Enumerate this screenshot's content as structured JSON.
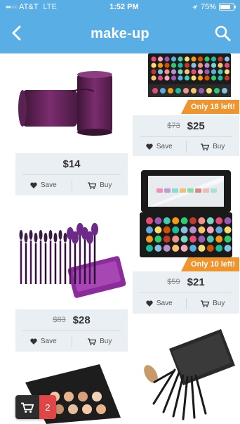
{
  "status_bar": {
    "carrier": "AT&T",
    "network": "LTE",
    "time": "1:52 PM",
    "battery": "75%",
    "battery_level": 0.75
  },
  "header": {
    "title": "make-up",
    "back_icon": "chevron-left-icon",
    "search_icon": "search-icon"
  },
  "actions": {
    "save_label": "Save",
    "buy_label": "Buy"
  },
  "products": [
    {
      "id": "brush-holder",
      "old_price": "",
      "price": "$14",
      "badge": ""
    },
    {
      "id": "palette-large",
      "old_price": "$73",
      "price": "$25",
      "badge": "Only 18 left!"
    },
    {
      "id": "brush-set-purple",
      "old_price": "$83",
      "price": "$28",
      "badge": ""
    },
    {
      "id": "palette-mirror",
      "old_price": "$59",
      "price": "$21",
      "badge": "Only 10 left!"
    }
  ],
  "cart": {
    "count": "2"
  },
  "colors": {
    "header_bg": "#5aaee6",
    "card_bg": "#eaeff3",
    "badge_bg": "#f0942e",
    "cart_count_bg": "#e04646"
  }
}
